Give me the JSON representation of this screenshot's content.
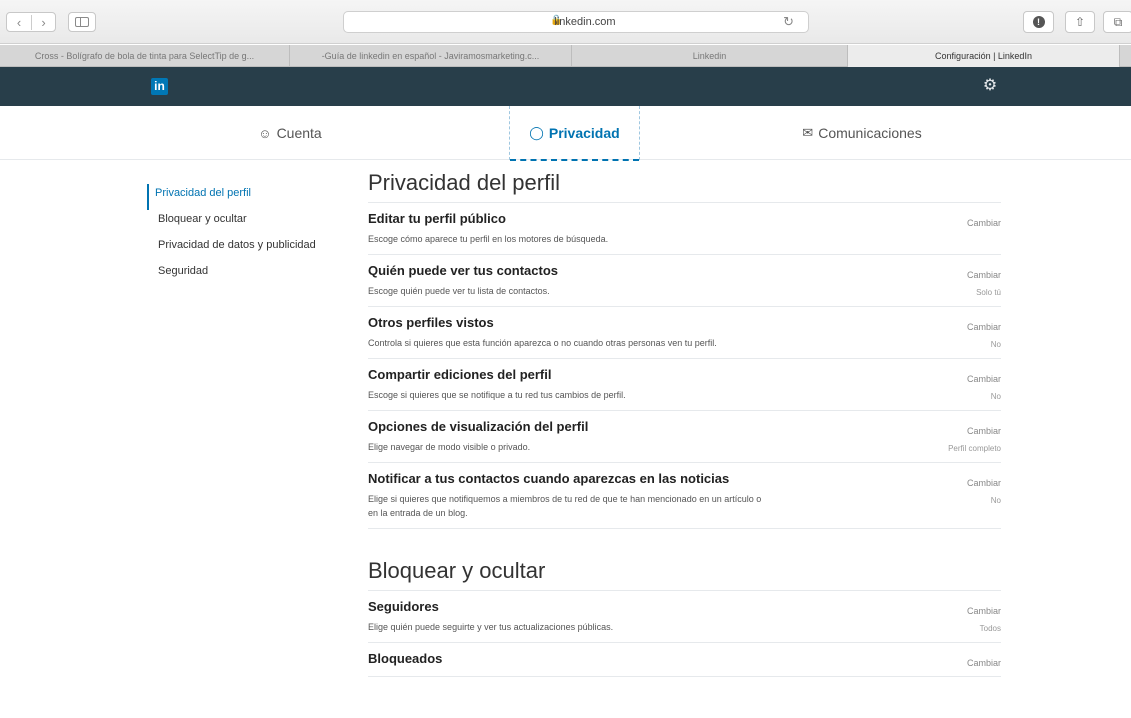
{
  "browser": {
    "url": "linkedin.com",
    "tabs": [
      {
        "label": "Cross - Bolígrafo de bola de tinta para SelectTip de g..."
      },
      {
        "label": "-Guía de linkedin en español - Javiramosmarketing.c..."
      },
      {
        "label": "Linkedin"
      },
      {
        "label": "Configuración | LinkedIn"
      }
    ]
  },
  "header": {
    "logo": "in"
  },
  "settings_tabs": [
    {
      "label": "Cuenta",
      "icon": "user-circle-icon"
    },
    {
      "label": "Privacidad",
      "icon": "shield-icon"
    },
    {
      "label": "Comunicaciones",
      "icon": "envelope-icon"
    }
  ],
  "left_menu": [
    {
      "label": "Privacidad del perfil"
    },
    {
      "label": "Bloquear y ocultar"
    },
    {
      "label": "Privacidad de datos y publicidad"
    },
    {
      "label": "Seguridad"
    }
  ],
  "sections": [
    {
      "title": "Privacidad del perfil",
      "rows": [
        {
          "title": "Editar tu perfil público",
          "desc": "Escoge cómo aparece tu perfil en los motores de búsqueda.",
          "action": "Cambiar",
          "value": ""
        },
        {
          "title": "Quién puede ver tus contactos",
          "desc": "Escoge quién puede ver tu lista de contactos.",
          "action": "Cambiar",
          "value": "Solo tú"
        },
        {
          "title": "Otros perfiles vistos",
          "desc": "Controla si quieres que esta función aparezca o no cuando otras personas ven tu perfil.",
          "action": "Cambiar",
          "value": "No"
        },
        {
          "title": "Compartir ediciones del perfil",
          "desc": "Escoge si quieres que se notifique a tu red tus cambios de perfil.",
          "action": "Cambiar",
          "value": "No"
        },
        {
          "title": "Opciones de visualización del perfil",
          "desc": "Elige navegar de modo visible o privado.",
          "action": "Cambiar",
          "value": "Perfil completo"
        },
        {
          "title": "Notificar a tus contactos cuando aparezcas en las noticias",
          "desc": "Elige si quieres que notifiquemos a miembros de tu red de que te han mencionado en un artículo o en la entrada de un blog.",
          "action": "Cambiar",
          "value": "No"
        }
      ]
    },
    {
      "title": "Bloquear y ocultar",
      "rows": [
        {
          "title": "Seguidores",
          "desc": "Elige quién puede seguirte y ver tus actualizaciones públicas.",
          "action": "Cambiar",
          "value": "Todos"
        },
        {
          "title": "Bloqueados",
          "desc": "",
          "action": "Cambiar",
          "value": ""
        }
      ]
    }
  ]
}
